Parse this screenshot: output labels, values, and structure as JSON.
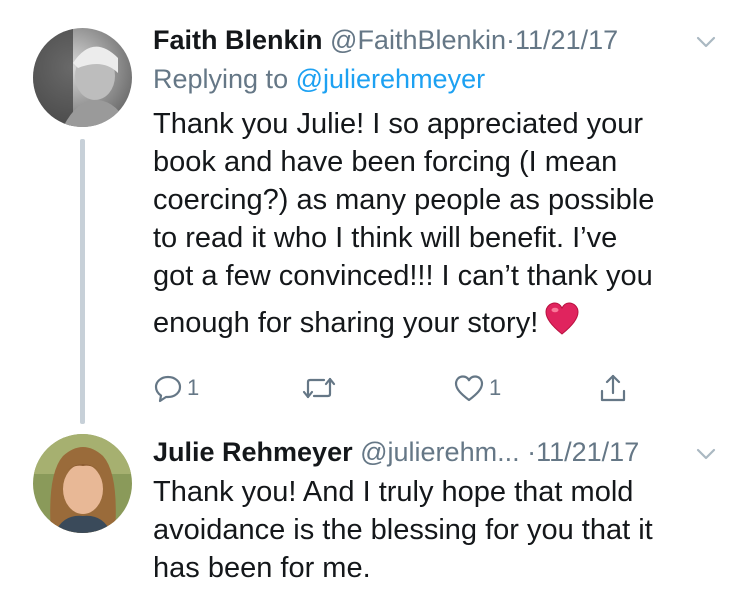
{
  "tweets": [
    {
      "name": "Faith Blenkin",
      "handle": "@FaithBlenkin",
      "separator": "·",
      "date": "11/21/17",
      "replying_label": "Replying to",
      "replying_handle": "@julierehmeyer",
      "text_lines": [
        "Thank you Julie! I so appreciated your",
        "book and have been forcing (I mean",
        "coercing?) as many people as possible",
        "to read it who I think will benefit. I’ve",
        "got a few convinced!!! I can’t thank you",
        "enough for sharing your story!"
      ],
      "emoji": "heart-emoji",
      "actions": {
        "reply_count": "1",
        "retweet_count": "",
        "like_count": "1"
      }
    },
    {
      "name": "Julie Rehmeyer",
      "handle": "@julierehm...",
      "separator": "·",
      "date": "11/21/17",
      "text_lines": [
        "Thank you! And I truly hope that mold",
        "avoidance is the blessing for you that it",
        "has been for me."
      ]
    }
  ],
  "colors": {
    "text": "#14171a",
    "meta": "#657786",
    "link": "#1da1f2",
    "thread_line": "#c7d0d8",
    "heart": "#e0245e"
  },
  "icons": [
    "chevron-down-icon",
    "reply-icon",
    "retweet-icon",
    "like-icon",
    "share-icon"
  ]
}
